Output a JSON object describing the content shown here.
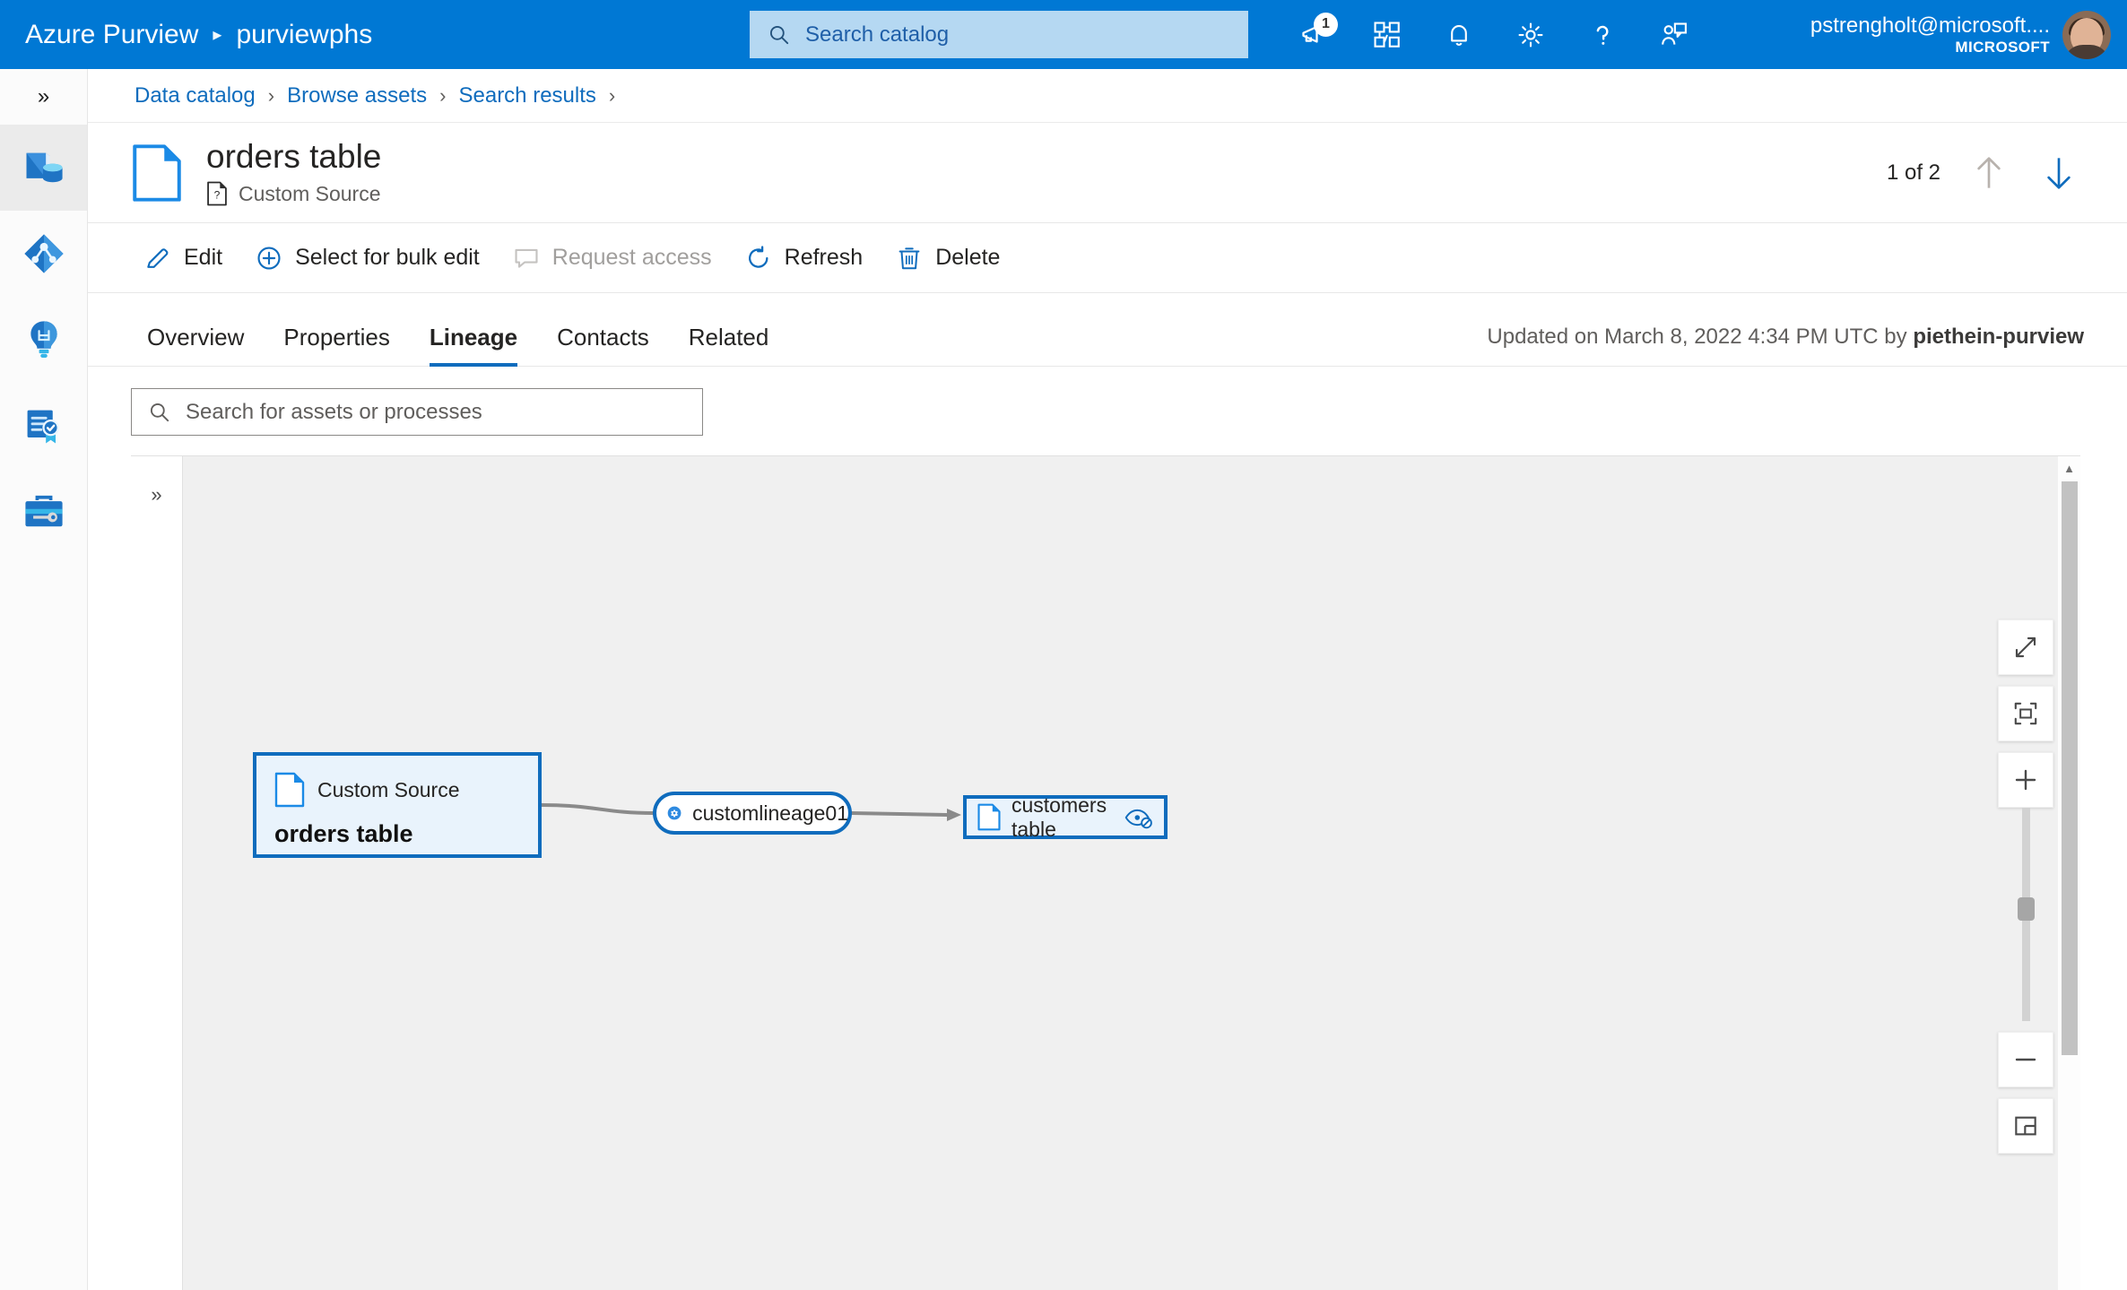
{
  "header": {
    "brand": "Azure Purview",
    "separator": "▸",
    "account": "purviewphs",
    "search_placeholder": "Search catalog",
    "notification_badge": "1",
    "icons": [
      {
        "name": "announcements-icon",
        "badge": "1"
      },
      {
        "name": "workflow-icon"
      },
      {
        "name": "bell-icon"
      },
      {
        "name": "gear-icon"
      },
      {
        "name": "help-icon"
      },
      {
        "name": "feedback-icon"
      }
    ],
    "user_name": "pstrengholt@microsoft....",
    "user_org": "MICROSOFT"
  },
  "rail": {
    "collapse_glyph": "»",
    "items": [
      {
        "label": "Data catalog",
        "icon": "data-catalog-icon",
        "active": true
      },
      {
        "label": "Data map",
        "icon": "data-map-icon",
        "active": false
      },
      {
        "label": "Insights",
        "icon": "insights-lightbulb-icon",
        "active": false
      },
      {
        "label": "Data policy",
        "icon": "policy-certificate-icon",
        "active": false
      },
      {
        "label": "Management",
        "icon": "management-toolbox-icon",
        "active": false
      }
    ]
  },
  "breadcrumb": {
    "items": [
      "Data catalog",
      "Browse assets",
      "Search results"
    ],
    "separator": "›",
    "trailing_separator": "›"
  },
  "asset": {
    "title": "orders table",
    "source_type": "Custom Source",
    "record_position": "1 of 2",
    "prev_label": "Previous asset",
    "next_label": "Next asset"
  },
  "toolbar": {
    "buttons": [
      {
        "label": "Edit",
        "icon": "pencil-icon",
        "disabled": false
      },
      {
        "label": "Select for bulk edit",
        "icon": "plus-circle-icon",
        "disabled": false
      },
      {
        "label": "Request access",
        "icon": "comment-icon",
        "disabled": true
      },
      {
        "label": "Refresh",
        "icon": "refresh-icon",
        "disabled": false
      },
      {
        "label": "Delete",
        "icon": "trash-icon",
        "disabled": false
      }
    ]
  },
  "tabs": {
    "items": [
      {
        "label": "Overview",
        "active": false
      },
      {
        "label": "Properties",
        "active": false
      },
      {
        "label": "Lineage",
        "active": true
      },
      {
        "label": "Contacts",
        "active": false
      },
      {
        "label": "Related",
        "active": false
      }
    ],
    "updated_prefix": "Updated on March 8, 2022 4:34 PM UTC by ",
    "updated_user": "piethein-purview"
  },
  "lineage": {
    "search_placeholder": "Search for assets or processes",
    "panel_collapse_glyph": "»",
    "nodes": [
      {
        "id": "orders",
        "kind": "asset",
        "source_type": "Custom Source",
        "name": "orders table",
        "selected": true
      },
      {
        "id": "proc",
        "kind": "process",
        "name": "customlineage01",
        "icon": "gear-icon"
      },
      {
        "id": "customers",
        "kind": "asset",
        "name": "customers table",
        "icon": "hide-eye-icon"
      }
    ],
    "edges": [
      {
        "from": "orders",
        "to": "proc"
      },
      {
        "from": "proc",
        "to": "customers"
      }
    ],
    "zoom_controls": [
      {
        "name": "expand-icon",
        "label": "Expand"
      },
      {
        "name": "fit-to-screen-icon",
        "label": "Fit to screen"
      },
      {
        "name": "zoom-in-icon",
        "label": "Zoom in"
      },
      {
        "name": "zoom-out-icon",
        "label": "Zoom out"
      },
      {
        "name": "minimap-icon",
        "label": "Show minimap"
      }
    ]
  },
  "colors": {
    "brand_blue": "#0078d4",
    "accent_blue": "#0f6cbd",
    "node_fill": "#e9f3fc",
    "canvas": "#f0f0f0",
    "edge_gray": "#8a8a8a"
  }
}
